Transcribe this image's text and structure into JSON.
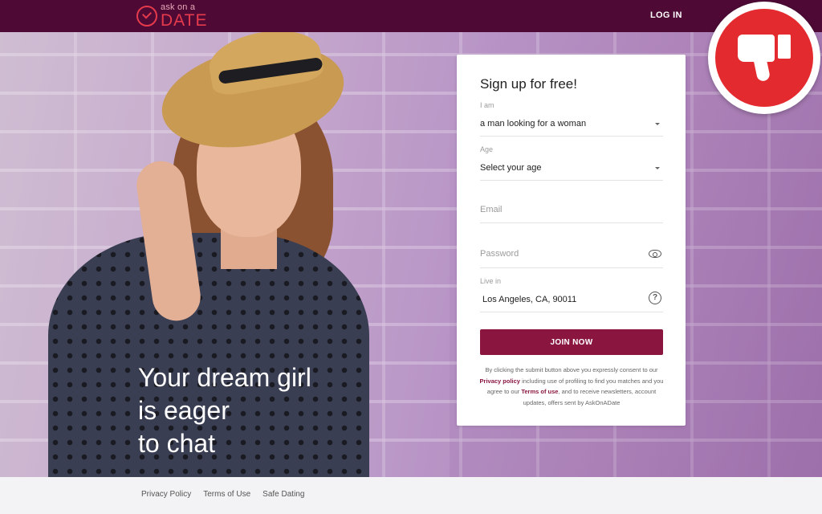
{
  "header": {
    "logo_small": "ask on a",
    "logo_big": "DATE",
    "login_label": "LOG IN"
  },
  "hero": {
    "lines": [
      "Your dream girl",
      "is eager",
      "to chat"
    ]
  },
  "form": {
    "title": "Sign up for free!",
    "iam_label": "I am",
    "iam_value": "a man looking for a woman",
    "age_label": "Age",
    "age_value": "Select your age",
    "email_placeholder": "Email",
    "password_placeholder": "Password",
    "livein_label": "Live in",
    "livein_value": "Los Angeles, CA, 90011",
    "join_label": "JOIN NOW",
    "consent_1": "By clicking the submit button above you expressly consent to our",
    "privacy_link": "Privacy policy",
    "consent_2": "including use of profiling to find you matches and you agree to our",
    "terms_link": "Terms of use",
    "consent_3": ", and to receive newsletters, account updates, offers sent by AskOnADate"
  },
  "footer": {
    "links": [
      "Privacy Policy",
      "Terms of Use",
      "Safe Dating"
    ]
  },
  "badge": {
    "icon": "thumbs-down-icon",
    "color": "#e32a2e"
  },
  "colors": {
    "brand": "#4e0a35",
    "accent": "#8a1640",
    "logo": "#e53a4c"
  }
}
